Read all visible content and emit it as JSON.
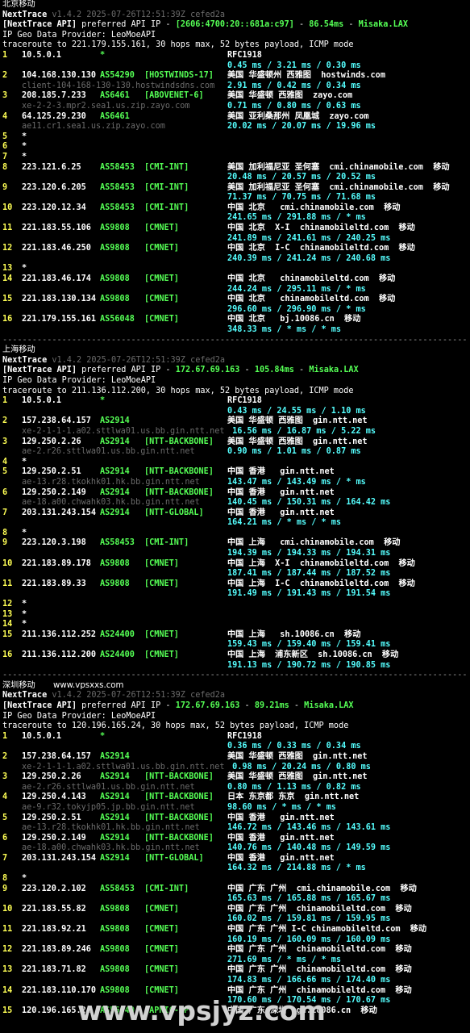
{
  "watermark": "www.vpsjyz.com",
  "sections": [
    {
      "title": "北京移动",
      "site_label": "",
      "nexttrace": "NextTrace",
      "version": "v1.4.2 2025-07-26T12:51:39Z cefed2a",
      "api_prefix": "[NextTrace API]",
      "api_mid": " preferred API IP - ",
      "api_ip": "[2606:4700:20::681a:c97]",
      "api_dash": " - ",
      "api_ms": "86.54ms",
      "api_dash2": " - ",
      "api_node": "Misaka.LAX",
      "geo_provider": "IP Geo Data Provider: LeoMoeAPI",
      "traceroute": "traceroute to 221.179.155.161, 30 hops max, 52 bytes payload, ICMP mode",
      "hops": [
        {
          "n": "1",
          "ip": "10.5.0.1",
          "asn": "*",
          "tag": "",
          "geo": "RFC1918",
          "rtt": "0.45 ms / 3.21 ms / 0.30 ms",
          "host": ""
        },
        {
          "n": "2",
          "ip": "104.168.130.130",
          "asn": "AS54290",
          "tag": "[HOSTWINDS-17]",
          "geo": "美国 华盛顿州 西雅图  hostwinds.com",
          "rtt": "2.91 ms / 0.42 ms / 0.34 ms",
          "host": "client-104-168-130-130.hostwindsdns.com"
        },
        {
          "n": "3",
          "ip": "208.185.7.233",
          "asn": "AS6461",
          "tag": "[ABOVENET-6]",
          "geo": "美国 华盛顿 西雅图  zayo.com",
          "rtt": "0.71 ms / 0.80 ms / 0.63 ms",
          "host": "xe-2-2-3.mpr2.sea1.us.zip.zayo.com"
        },
        {
          "n": "4",
          "ip": "64.125.29.230",
          "asn": "AS6461",
          "tag": "",
          "geo": "美国 亚利桑那州 凤凰城  zayo.com",
          "rtt": "20.02 ms / 20.07 ms / 19.96 ms",
          "host": "ae11.cr1.sea1.us.zip.zayo.com"
        },
        {
          "n": "5",
          "ip": "*",
          "asn": "",
          "tag": "",
          "geo": "",
          "rtt": "",
          "host": ""
        },
        {
          "n": "6",
          "ip": "*",
          "asn": "",
          "tag": "",
          "geo": "",
          "rtt": "",
          "host": ""
        },
        {
          "n": "7",
          "ip": "*",
          "asn": "",
          "tag": "",
          "geo": "",
          "rtt": "",
          "host": ""
        },
        {
          "n": "8",
          "ip": "223.121.6.25",
          "asn": "AS58453",
          "tag": "[CMI-INT]",
          "geo": "美国 加利福尼亚 圣何塞  cmi.chinamobile.com  移动",
          "rtt": "20.48 ms / 20.57 ms / 20.52 ms",
          "host": ""
        },
        {
          "n": "9",
          "ip": "223.120.6.205",
          "asn": "AS58453",
          "tag": "[CMI-INT]",
          "geo": "美国 加利福尼亚 圣何塞  cmi.chinamobile.com  移动",
          "rtt": "71.37 ms / 70.75 ms / 71.68 ms",
          "host": ""
        },
        {
          "n": "10",
          "ip": "223.120.12.34",
          "asn": "AS58453",
          "tag": "[CMI-INT]",
          "geo": "中国 北京   cmi.chinamobile.com  移动",
          "rtt": "241.65 ms / 291.88 ms / * ms",
          "host": ""
        },
        {
          "n": "11",
          "ip": "221.183.55.106",
          "asn": "AS9808",
          "tag": "[CMNET]",
          "geo": "中国 北京  X-I  chinamobileltd.com  移动",
          "rtt": "241.89 ms / 241.61 ms / 240.25 ms",
          "host": ""
        },
        {
          "n": "12",
          "ip": "221.183.46.250",
          "asn": "AS9808",
          "tag": "[CMNET]",
          "geo": "中国 北京  I-C  chinamobileltd.com  移动",
          "rtt": "240.39 ms / 241.24 ms / 240.68 ms",
          "host": ""
        },
        {
          "n": "13",
          "ip": "*",
          "asn": "",
          "tag": "",
          "geo": "",
          "rtt": "",
          "host": ""
        },
        {
          "n": "14",
          "ip": "221.183.46.174",
          "asn": "AS9808",
          "tag": "[CMNET]",
          "geo": "中国 北京   chinamobileltd.com  移动",
          "rtt": "244.24 ms / 295.11 ms / * ms",
          "host": ""
        },
        {
          "n": "15",
          "ip": "221.183.130.134",
          "asn": "AS9808",
          "tag": "[CMNET]",
          "geo": "中国 北京   chinamobileltd.com  移动",
          "rtt": "296.60 ms / 296.90 ms / * ms",
          "host": ""
        },
        {
          "n": "16",
          "ip": "221.179.155.161",
          "asn": "AS56048",
          "tag": "[CMNET]",
          "geo": "中国 北京   bj.10086.cn  移动",
          "rtt": "348.33 ms / * ms / * ms",
          "host": ""
        }
      ]
    },
    {
      "title": "上海移动",
      "site_label": "",
      "nexttrace": "NextTrace",
      "version": "v1.4.2 2025-07-26T12:51:39Z cefed2a",
      "api_prefix": "[NextTrace API]",
      "api_mid": " preferred API IP - ",
      "api_ip": "172.67.69.163",
      "api_dash": " - ",
      "api_ms": "105.84ms",
      "api_dash2": " - ",
      "api_node": "Misaka.LAX",
      "geo_provider": "IP Geo Data Provider: LeoMoeAPI",
      "traceroute": "traceroute to 211.136.112.200, 30 hops max, 52 bytes payload, ICMP mode",
      "hops": [
        {
          "n": "1",
          "ip": "10.5.0.1",
          "asn": "*",
          "tag": "",
          "geo": "RFC1918",
          "rtt": "0.43 ms / 24.55 ms / 1.10 ms",
          "host": ""
        },
        {
          "n": "2",
          "ip": "157.238.64.157",
          "asn": "AS2914",
          "tag": "",
          "geo": "美国 华盛顿 西雅图  gin.ntt.net",
          "rtt": " 16.56 ms / 16.87 ms / 5.22 ms",
          "host": "xe-2-1-1-1.a02.sttlwa01.us.bb.gin.ntt.net"
        },
        {
          "n": "3",
          "ip": "129.250.2.26",
          "asn": "AS2914",
          "tag": "[NTT-BACKBONE]",
          "geo": "美国 华盛顿 西雅图  gin.ntt.net",
          "rtt": "0.90 ms / 1.01 ms / 0.87 ms",
          "host": "ae-2.r26.sttlwa01.us.bb.gin.ntt.net"
        },
        {
          "n": "4",
          "ip": "*",
          "asn": "",
          "tag": "",
          "geo": "",
          "rtt": "",
          "host": ""
        },
        {
          "n": "5",
          "ip": "129.250.2.51",
          "asn": "AS2914",
          "tag": "[NTT-BACKBONE]",
          "geo": "中国 香港   gin.ntt.net",
          "rtt": "143.47 ms / 143.49 ms / * ms",
          "host": "ae-13.r28.tkokhk01.hk.bb.gin.ntt.net"
        },
        {
          "n": "6",
          "ip": "129.250.2.149",
          "asn": "AS2914",
          "tag": "[NTT-BACKBONE]",
          "geo": "中国 香港   gin.ntt.net",
          "rtt": "140.45 ms / 150.31 ms / 164.42 ms",
          "host": "ae-18.a00.chwahk03.hk.bb.gin.ntt.net"
        },
        {
          "n": "7",
          "ip": "203.131.243.154",
          "asn": "AS2914",
          "tag": "[NTT-GLOBAL]",
          "geo": "中国 香港   gin.ntt.net",
          "rtt": "164.21 ms / * ms / * ms",
          "host": ""
        },
        {
          "n": "8",
          "ip": "*",
          "asn": "",
          "tag": "",
          "geo": "",
          "rtt": "",
          "host": ""
        },
        {
          "n": "9",
          "ip": "223.120.3.198",
          "asn": "AS58453",
          "tag": "[CMI-INT]",
          "geo": "中国 上海   cmi.chinamobile.com  移动",
          "rtt": "194.39 ms / 194.33 ms / 194.31 ms",
          "host": ""
        },
        {
          "n": "10",
          "ip": "221.183.89.178",
          "asn": "AS9808",
          "tag": "[CMNET]",
          "geo": "中国 上海  X-I  chinamobileltd.com  移动",
          "rtt": "187.41 ms / 187.44 ms / 187.52 ms",
          "host": ""
        },
        {
          "n": "11",
          "ip": "221.183.89.33",
          "asn": "AS9808",
          "tag": "[CMNET]",
          "geo": "中国 上海  I-C  chinamobileltd.com  移动",
          "rtt": "191.49 ms / 191.43 ms / 191.54 ms",
          "host": ""
        },
        {
          "n": "12",
          "ip": "*",
          "asn": "",
          "tag": "",
          "geo": "",
          "rtt": "",
          "host": ""
        },
        {
          "n": "13",
          "ip": "*",
          "asn": "",
          "tag": "",
          "geo": "",
          "rtt": "",
          "host": ""
        },
        {
          "n": "14",
          "ip": "*",
          "asn": "",
          "tag": "",
          "geo": "",
          "rtt": "",
          "host": ""
        },
        {
          "n": "15",
          "ip": "211.136.112.252",
          "asn": "AS24400",
          "tag": "[CMNET]",
          "geo": "中国 上海   sh.10086.cn  移动",
          "rtt": "159.43 ms / 159.40 ms / 159.41 ms",
          "host": ""
        },
        {
          "n": "16",
          "ip": "211.136.112.200",
          "asn": "AS24400",
          "tag": "[CMNET]",
          "geo": "中国 上海  浦东新区  sh.10086.cn  移动",
          "rtt": "191.13 ms / 190.72 ms / 190.85 ms",
          "host": ""
        }
      ]
    },
    {
      "title": "深圳移动",
      "site_label": "www.vpsxxs.com",
      "nexttrace": "NextTrace",
      "version": "v1.4.2 2025-07-26T12:51:39Z cefed2a",
      "api_prefix": "[NextTrace API]",
      "api_mid": " preferred API IP - ",
      "api_ip": "172.67.69.163",
      "api_dash": " - ",
      "api_ms": "89.21ms",
      "api_dash2": " - ",
      "api_node": "Misaka.LAX",
      "geo_provider": "IP Geo Data Provider: LeoMoeAPI",
      "traceroute": "traceroute to 120.196.165.24, 30 hops max, 52 bytes payload, ICMP mode",
      "hops": [
        {
          "n": "1",
          "ip": "10.5.0.1",
          "asn": "*",
          "tag": "",
          "geo": "RFC1918",
          "rtt": "0.36 ms / 0.33 ms / 0.34 ms",
          "host": ""
        },
        {
          "n": "2",
          "ip": "157.238.64.157",
          "asn": "AS2914",
          "tag": "",
          "geo": "美国 华盛顿 西雅图  gin.ntt.net",
          "rtt": " 0.98 ms / 20.24 ms / 0.80 ms",
          "host": "xe-2-1-1-1.a02.sttlwa01.us.bb.gin.ntt.net"
        },
        {
          "n": "3",
          "ip": "129.250.2.26",
          "asn": "AS2914",
          "tag": "[NTT-BACKBONE]",
          "geo": "美国 华盛顿 西雅图  gin.ntt.net",
          "rtt": "0.80 ms / 1.13 ms / 0.82 ms",
          "host": "ae-2.r26.sttlwa01.us.bb.gin.ntt.net"
        },
        {
          "n": "4",
          "ip": "129.250.4.143",
          "asn": "AS2914",
          "tag": "[NTT-BACKBONE]",
          "geo": "日本 东京都 东京  gin.ntt.net",
          "rtt": "98.60 ms / * ms / * ms",
          "host": "ae-9.r32.tokyjp05.jp.bb.gin.ntt.net"
        },
        {
          "n": "5",
          "ip": "129.250.2.51",
          "asn": "AS2914",
          "tag": "[NTT-BACKBONE]",
          "geo": "中国 香港   gin.ntt.net",
          "rtt": "146.72 ms / 143.46 ms / 143.61 ms",
          "host": "ae-13.r28.tkokhk01.hk.bb.gin.ntt.net"
        },
        {
          "n": "6",
          "ip": "129.250.2.149",
          "asn": "AS2914",
          "tag": "[NTT-BACKBONE]",
          "geo": "中国 香港   gin.ntt.net",
          "rtt": "140.76 ms / 140.48 ms / 149.59 ms",
          "host": "ae-18.a00.chwahk03.hk.bb.gin.ntt.net"
        },
        {
          "n": "7",
          "ip": "203.131.243.154",
          "asn": "AS2914",
          "tag": "[NTT-GLOBAL]",
          "geo": "中国 香港   gin.ntt.net",
          "rtt": "164.32 ms / 214.88 ms / * ms",
          "host": ""
        },
        {
          "n": "8",
          "ip": "*",
          "asn": "",
          "tag": "",
          "geo": "",
          "rtt": "",
          "host": ""
        },
        {
          "n": "9",
          "ip": "223.120.2.102",
          "asn": "AS58453",
          "tag": "[CMI-INT]",
          "geo": "中国 广东 广州  cmi.chinamobile.com  移动",
          "rtt": "165.63 ms / 165.88 ms / 165.67 ms",
          "host": ""
        },
        {
          "n": "10",
          "ip": "221.183.55.82",
          "asn": "AS9808",
          "tag": "[CMNET]",
          "geo": "中国 广东 广州  chinamobileltd.com  移动",
          "rtt": "160.02 ms / 159.81 ms / 159.95 ms",
          "host": ""
        },
        {
          "n": "11",
          "ip": "221.183.92.21",
          "asn": "AS9808",
          "tag": "[CMNET]",
          "geo": "中国 广东 广州 I-C chinamobileltd.com  移动",
          "rtt": "160.19 ms / 160.09 ms / 160.09 ms",
          "host": ""
        },
        {
          "n": "12",
          "ip": "221.183.89.246",
          "asn": "AS9808",
          "tag": "[CMNET]",
          "geo": "中国 广东 广州  chinamobileltd.com  移动",
          "rtt": "271.69 ms / * ms / * ms",
          "host": ""
        },
        {
          "n": "13",
          "ip": "221.183.71.82",
          "asn": "AS9808",
          "tag": "[CMNET]",
          "geo": "中国 广东 广州  chinamobileltd.com  移动",
          "rtt": "174.83 ms / 166.66 ms / 174.40 ms",
          "host": ""
        },
        {
          "n": "14",
          "ip": "221.183.110.170",
          "asn": "AS9808",
          "tag": "[CMNET]",
          "geo": "中国 广东 广州  chinamobileltd.com  移动",
          "rtt": "170.60 ms / 170.54 ms / 170.67 ms",
          "host": ""
        },
        {
          "n": "15",
          "ip": "120.196.165.24",
          "asn": "AS56040",
          "tag": "[APNIC-AP]",
          "geo": "中国 广东 深圳  gd.10086.cn  移动",
          "rtt": "",
          "host": ""
        }
      ]
    }
  ],
  "separator": "----------------------------------------------------------------------------------------------"
}
